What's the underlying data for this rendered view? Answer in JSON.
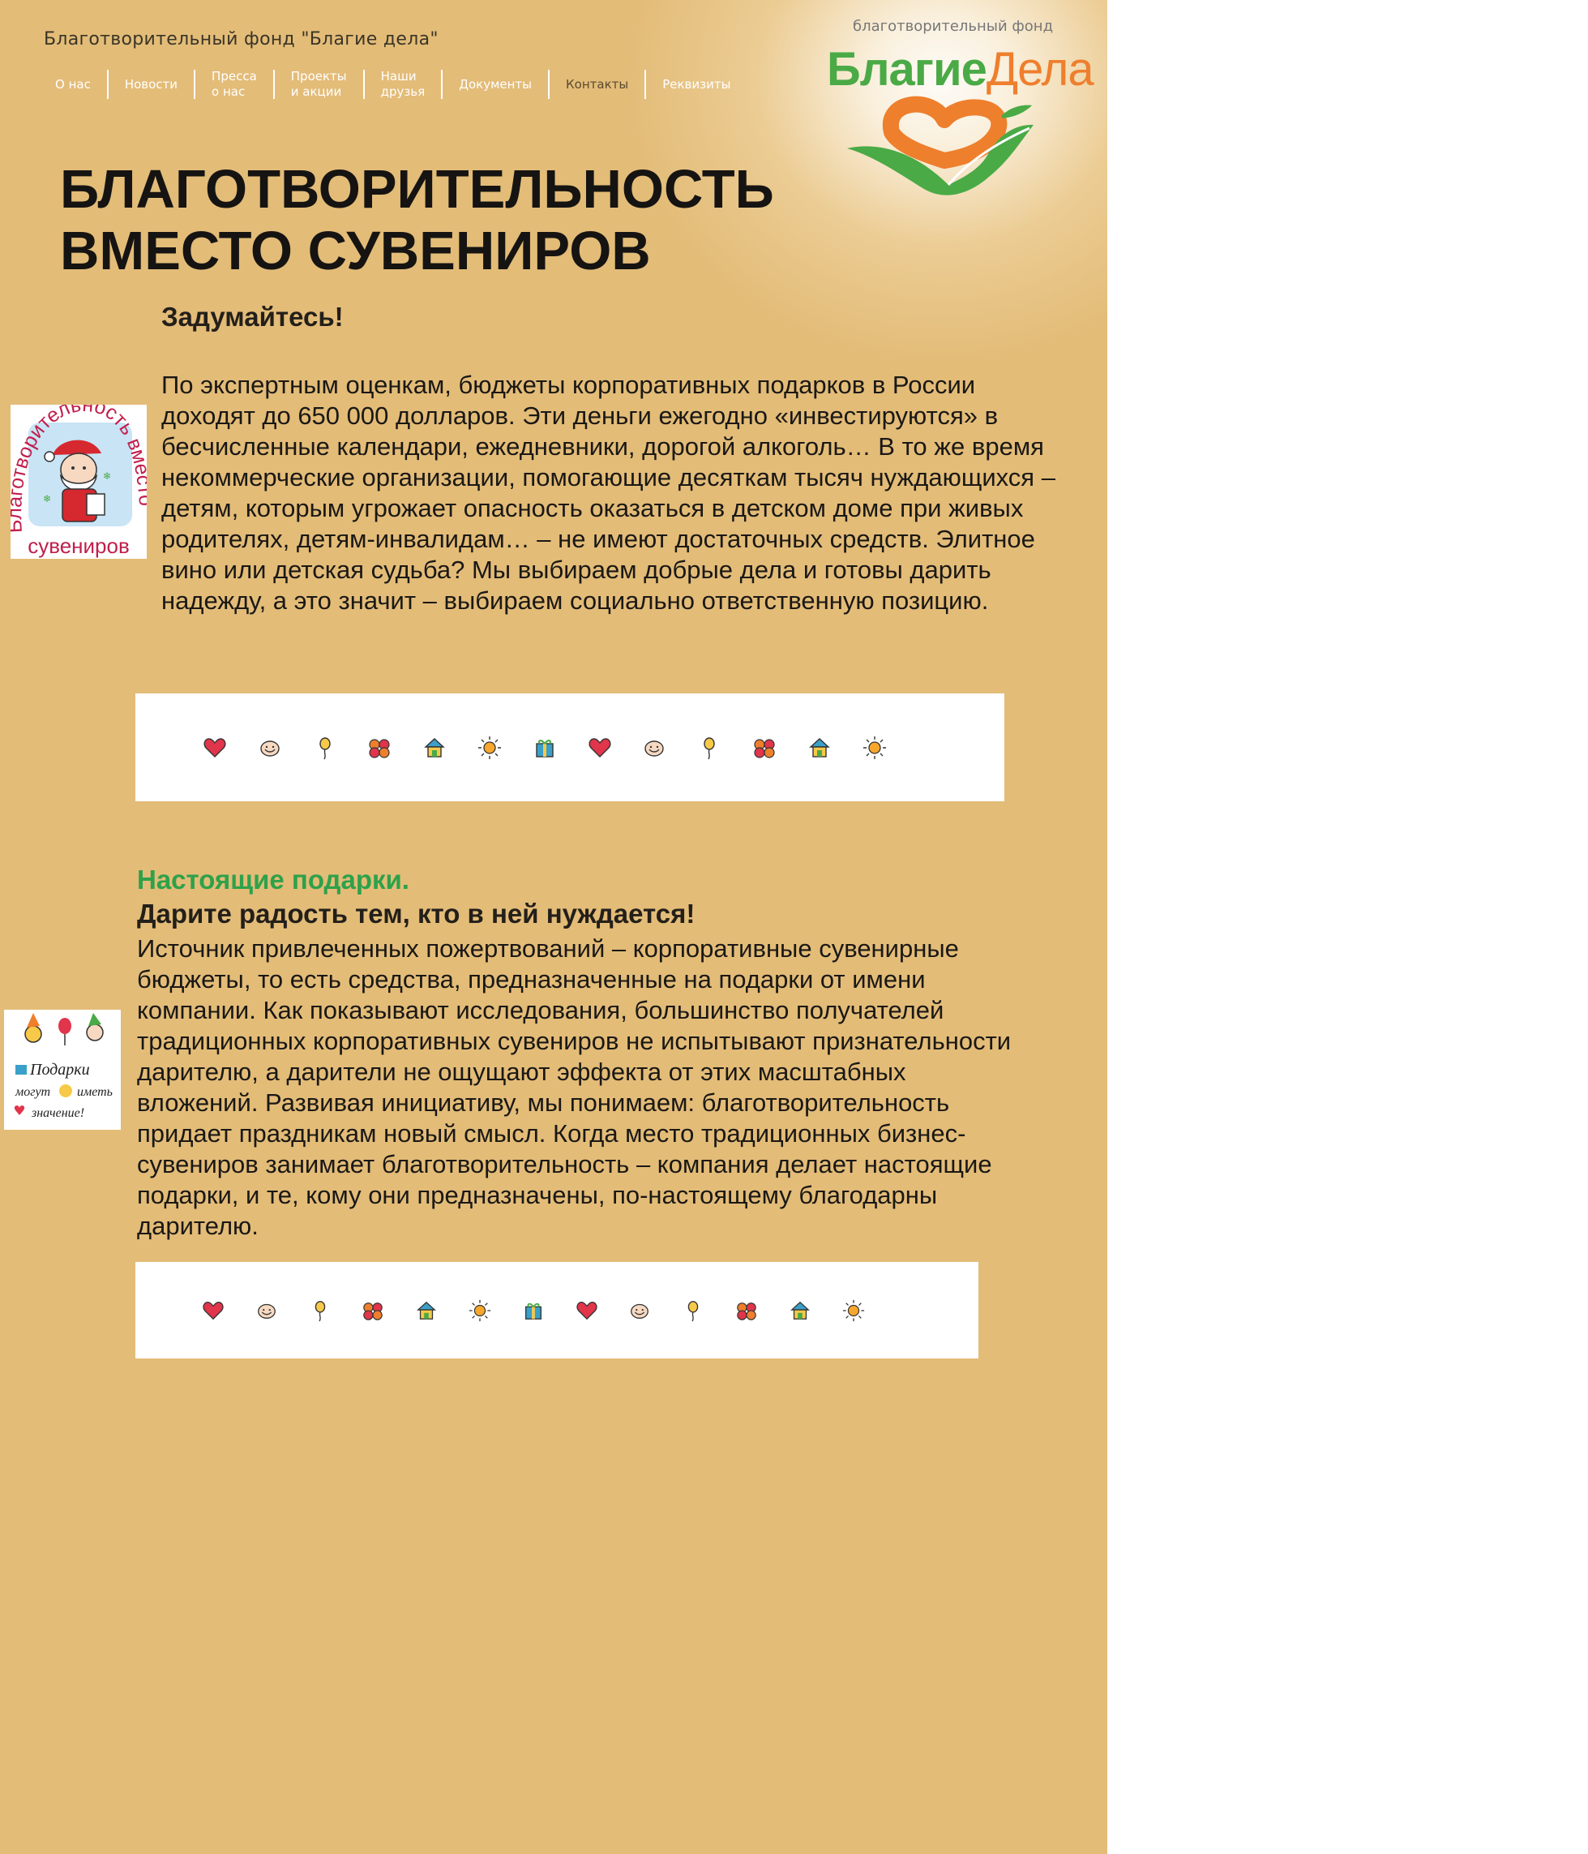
{
  "header": {
    "site_title": "Благотворительный фонд \"Благие дела\"",
    "nav": [
      {
        "label": "О нас",
        "name": "nav-about"
      },
      {
        "label": "Новости",
        "name": "nav-news"
      },
      {
        "label": "Пресса\nо нас",
        "name": "nav-press"
      },
      {
        "label": "Проекты\nи акции",
        "name": "nav-projects"
      },
      {
        "label": "Наши\nдрузья",
        "name": "nav-friends"
      },
      {
        "label": "Документы",
        "name": "nav-documents"
      },
      {
        "label": "Контакты",
        "name": "nav-contacts"
      },
      {
        "label": "Реквизиты",
        "name": "nav-requisites"
      }
    ],
    "logo": {
      "caption": "благотворительный фонд",
      "name_part1": "Благие",
      "name_part2": "Дела",
      "green": "#4aaa46",
      "orange": "#ee7f2d"
    }
  },
  "main": {
    "heading": "БЛАГОТВОРИТЕЛЬНОСТЬ\nВМЕСТО СУВЕНИРОВ",
    "section1": {
      "subheading": "Задумайтесь!",
      "paragraph": "По экспертным оценкам, бюджеты корпоративных подарков в России доходят до  650 000   долларов. Эти деньги ежегодно «инвестируются» в бесчисленные календари, ежедневники, дорогой алкоголь… В то же время некоммерческие организации, помогающие десяткам тысяч нуждающихся – детям, которым угрожает опасность оказаться в детском доме при живых родителях, детям-инвалидам… – не имеют достаточных средств. Элитное вино или детская судьба? Мы выбираем добрые дела и готовы дарить надежду, а это значит – выбираем социально ответственную позицию.",
      "badge_text_arc": "Благотворительность вместо",
      "badge_text_bottom": "сувениров"
    },
    "section2": {
      "green_heading": "Настоящие подарки.",
      "bold_line": "Дарите радость тем, кто в ней нуждается!",
      "paragraph": "Источник привлеченных пожертвований – корпоративные сувенирные бюджеты, то есть средства, предназначенные на подарки от имени компании. Как показывают исследования, большинство получателей традиционных корпоративных сувениров не испытывают признательности дарителю, а дарители не ощущают эффекта от этих масштабных вложений. Развивая инициативу, мы понимаем: благотворительность придает праздникам новый смысл. Когда место традиционных бизнес-сувениров занимает благотворительность – компания делает настоящие подарки, и те, кому они предназначены, по-настоящему благодарны дарителю.",
      "badge_line1": "Подарки",
      "badge_line2": "могут",
      "badge_line3": "иметь",
      "badge_line4": "значение!"
    },
    "icon_strip_1": [
      "heart-icon",
      "smiley-icon",
      "balloon-icon",
      "flower-icon",
      "house-icon",
      "sun-icon",
      "gift-icon",
      "heart-icon",
      "smiley-icon",
      "balloon-icon",
      "flower-icon",
      "house-icon",
      "sun-icon"
    ],
    "icon_strip_2": [
      "heart-icon",
      "smiley-icon",
      "balloon-icon",
      "flower-icon",
      "house-icon",
      "sun-icon",
      "gift-icon",
      "heart-icon",
      "smiley-icon",
      "balloon-icon",
      "flower-icon",
      "house-icon",
      "sun-icon"
    ]
  },
  "colors": {
    "page_background": "#e3bc78",
    "accent_green": "#2ea14a",
    "nav_text": "#ffffff"
  }
}
